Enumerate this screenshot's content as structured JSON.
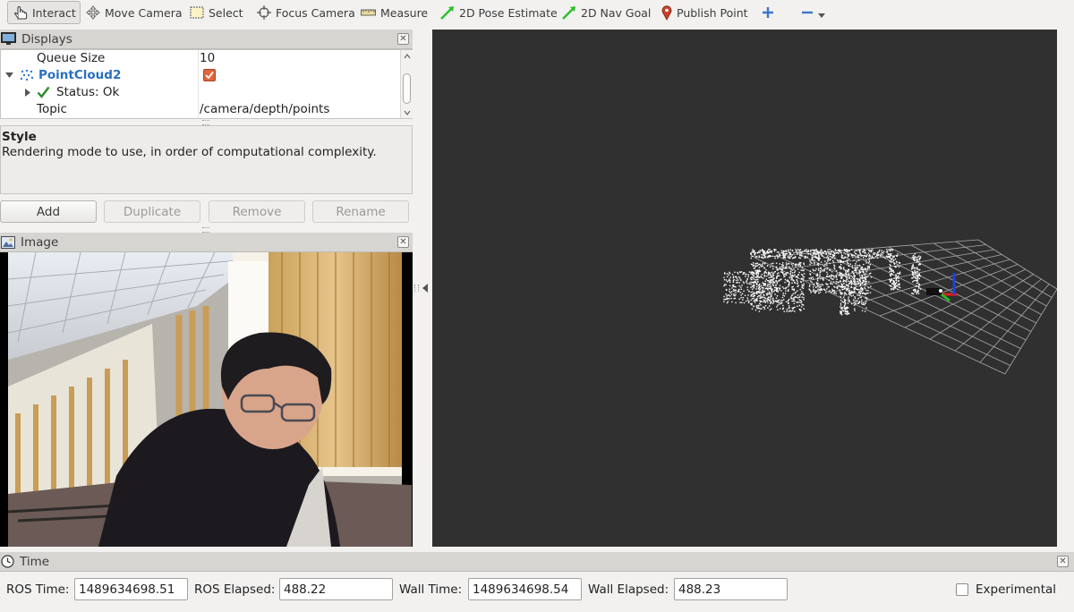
{
  "toolbar": {
    "interact": "Interact",
    "move_camera": "Move Camera",
    "select": "Select",
    "focus_camera": "Focus Camera",
    "measure": "Measure",
    "pose_estimate": "2D Pose Estimate",
    "nav_goal": "2D Nav Goal",
    "publish_point": "Publish Point"
  },
  "displays": {
    "title": "Displays",
    "rows": [
      {
        "label": "Queue Size",
        "value": "10"
      },
      {
        "label": "PointCloud2",
        "value": ""
      },
      {
        "label": "Status: Ok",
        "value": ""
      },
      {
        "label": "Topic",
        "value": "/camera/depth/points"
      }
    ],
    "pointcloud_enabled": true
  },
  "description": {
    "title": "Style",
    "text": "Rendering mode to use, in order of computational complexity."
  },
  "buttons": {
    "add": "Add",
    "duplicate": "Duplicate",
    "remove": "Remove",
    "rename": "Rename"
  },
  "image_panel": {
    "title": "Image"
  },
  "time_panel": {
    "title": "Time",
    "ros_time_label": "ROS Time:",
    "ros_time": "1489634698.51",
    "ros_elapsed_label": "ROS Elapsed:",
    "ros_elapsed": "488.22",
    "wall_time_label": "Wall Time:",
    "wall_time": "1489634698.54",
    "wall_elapsed_label": "Wall Elapsed:",
    "wall_elapsed": "488.23",
    "experimental_label": "Experimental",
    "experimental_checked": false
  },
  "colors": {
    "pointcloud_label": "#2a6fc0",
    "render_background": "#303030",
    "status_ok": "#2a8a2a",
    "checkbox_fill": "#e0643c"
  }
}
